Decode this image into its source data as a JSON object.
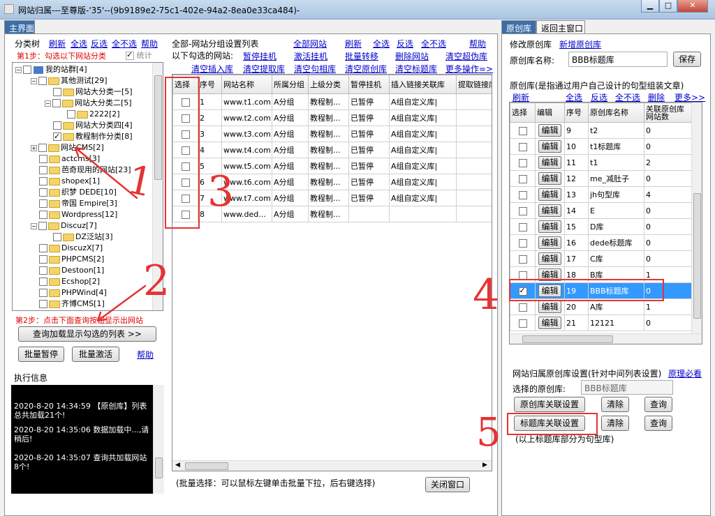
{
  "window": {
    "title": "网站归属---至尊版-'35'--(9b9189e2-75c1-402e-94a2-8ea0e33ca484)-"
  },
  "left_tab": "主界面",
  "left": {
    "title": "分类树",
    "links": [
      "刷新",
      "全选",
      "反选",
      "全不选",
      "帮助"
    ],
    "step1": "第1步：勾选以下网站分类",
    "stat_label": "统计",
    "tree": [
      "我的站群[4]",
      "其他测试[29]",
      "网站大分类一[5]",
      "网站大分类二[5]",
      "2222[2]",
      "网站大分类四[4]",
      "教程制作分类[8]",
      "网站CMS[2]",
      "actcms[3]",
      "芭奇现用的网站[23]",
      "shopex[1]",
      "织梦 DEDE[10]",
      "帝国 Empire[3]",
      "Wordpress[12]",
      "Discuz[7]",
      "DZ泛站[3]",
      "DiscuzX[7]",
      "PHPCMS[2]",
      "Destoon[1]",
      "Ecshop[2]",
      "PHPWind[4]",
      "齐博CMS[1]"
    ],
    "step2": "第2步：点击下面查询按钮显示出网站",
    "query_btn": "查询加载显示勾选的列表 >>",
    "pause_btn": "批量暂停",
    "activate_btn": "批量激活",
    "help": "帮助",
    "log_title": "执行信息",
    "logs": [
      "2020-8-20 14:34:59  【原创库】列表总共加载21个!",
      "2020-8-20 14:35:06  数据加载中...,请稍后!",
      "2020-8-20 14:35:07  查询共加载网站8个!"
    ]
  },
  "middle": {
    "title": "全部-网站分组设置列表",
    "links1": [
      "全部网站",
      "刷新",
      "全选",
      "反选",
      "全不选",
      "帮助"
    ],
    "subtitle": "以下勾选的网站:",
    "links2": [
      "暂停挂机",
      "激活挂机",
      "批量转移",
      "删除网站",
      "清空超伪库"
    ],
    "links3": [
      "清空插入库",
      "清空提取库",
      "清空句相库",
      "清空原创库",
      "清空标题库",
      "更多操作=>"
    ],
    "columns": [
      "选择",
      "序号",
      "网站名称",
      "所属分组",
      "上级分类",
      "暂停挂机",
      "插入链接关联库",
      "提取链接库"
    ],
    "rows": [
      [
        "1",
        "www.t1.com",
        "A分组",
        "教程制...",
        "已暂停",
        "A组自定义库|"
      ],
      [
        "2",
        "www.t2.com",
        "A分组",
        "教程制...",
        "已暂停",
        "A组自定义库|"
      ],
      [
        "3",
        "www.t3.com",
        "A分组",
        "教程制...",
        "已暂停",
        "A组自定义库|"
      ],
      [
        "4",
        "www.t4.com",
        "A分组",
        "教程制...",
        "已暂停",
        "A组自定义库|"
      ],
      [
        "5",
        "www.t5.com",
        "A分组",
        "教程制...",
        "已暂停",
        "A组自定义库|"
      ],
      [
        "6",
        "www.t6.com",
        "A分组",
        "教程制...",
        "已暂停",
        "A组自定义库|"
      ],
      [
        "7",
        "www.t7.com",
        "A分组",
        "教程制...",
        "已暂停",
        "A组自定义库|"
      ],
      [
        "8",
        "www.ded...",
        "A分组",
        "教程制...",
        "",
        ""
      ]
    ],
    "hint": "(批量选择：可以鼠标左键单击批量下拉，后右键选择)",
    "close_btn": "关闭窗口"
  },
  "right_tabs": [
    "原创库",
    "返回主窗口"
  ],
  "right": {
    "edit_title": "修改原创库",
    "new_link": "新增原创库",
    "name_label": "原创库名称:",
    "name_value": "BBB标题库",
    "save_btn": "保存",
    "list_title": "原创库(是指通过用户自己设计的句型组装文章)",
    "links": [
      "刷新",
      "全选",
      "反选",
      "全不选",
      "删除",
      "更多>>"
    ],
    "columns": [
      "选择",
      "编辑",
      "序号",
      "原创库名称",
      "关联原创库网站数"
    ],
    "edit_label": "编辑",
    "rows": [
      {
        "no": "9",
        "name": "t2",
        "count": "0",
        "checked": false
      },
      {
        "no": "10",
        "name": "t1标题库",
        "count": "0",
        "checked": false
      },
      {
        "no": "11",
        "name": "t1",
        "count": "2",
        "checked": false
      },
      {
        "no": "12",
        "name": "me_减肚子",
        "count": "0",
        "checked": false
      },
      {
        "no": "13",
        "name": "jh句型库",
        "count": "4",
        "checked": false
      },
      {
        "no": "14",
        "name": "E",
        "count": "0",
        "checked": false
      },
      {
        "no": "15",
        "name": "D库",
        "count": "0",
        "checked": false
      },
      {
        "no": "16",
        "name": "dede标题库",
        "count": "0",
        "checked": false
      },
      {
        "no": "17",
        "name": "C库",
        "count": "0",
        "checked": false
      },
      {
        "no": "18",
        "name": "B库",
        "count": "1",
        "checked": false
      },
      {
        "no": "19",
        "name": "BBB标题库",
        "count": "0",
        "checked": true
      },
      {
        "no": "20",
        "name": "A库",
        "count": "1",
        "checked": false
      },
      {
        "no": "21",
        "name": "12121",
        "count": "0",
        "checked": false
      }
    ],
    "settings_title": "网站归属原创库设置(针对中间列表设置)",
    "principle_link": "原理必看",
    "selected_label": "选择的原创库:",
    "selected_value": "BBB标题库",
    "assoc_btn": "原创库关联设置",
    "title_assoc_btn": "标题库关联设置",
    "clear_btn": "清除",
    "query_btn": "查询",
    "note": "(以上标题库部分为句型库)"
  },
  "annotations": [
    "1",
    "2",
    "3",
    "4",
    "5"
  ],
  "colors": {
    "annotation": "#e53333",
    "selection": "#3399ff",
    "link": "#0000cc"
  }
}
